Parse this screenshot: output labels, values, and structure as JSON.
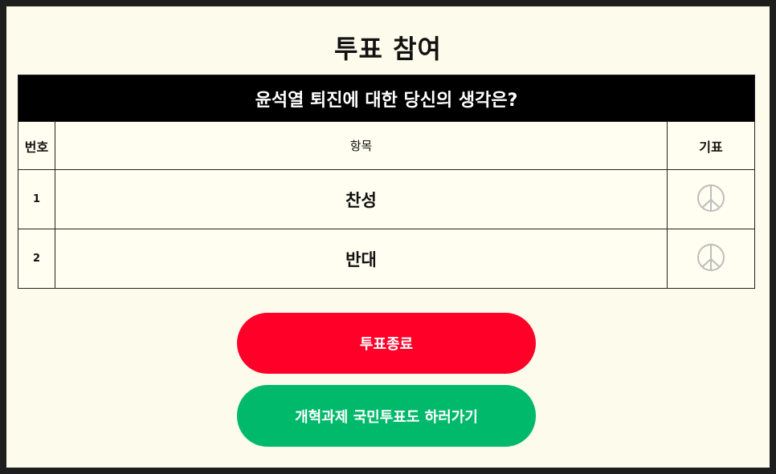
{
  "page": {
    "title": "투표 참여"
  },
  "poll": {
    "question": "윤석열 퇴진에 대한 당신의 생각은?",
    "headers": {
      "number": "번호",
      "item": "항목",
      "vote": "기표"
    },
    "options": [
      {
        "number": "1",
        "label": "찬성"
      },
      {
        "number": "2",
        "label": "반대"
      }
    ]
  },
  "buttons": {
    "end_vote": "투표종료",
    "go_reform": "개혁과제 국민투표도 하러가기"
  },
  "icons": {
    "vote_stamp": "peace-sign-icon"
  },
  "colors": {
    "background": "#fdfbeb",
    "end_button": "#ff0029",
    "go_button": "#00b96b",
    "question_bar": "#000000"
  }
}
